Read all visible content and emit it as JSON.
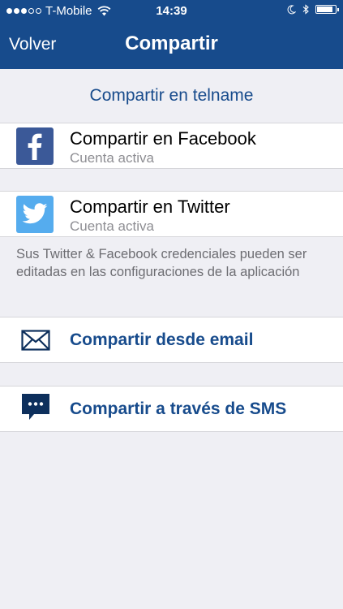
{
  "status_bar": {
    "carrier": "T-Mobile",
    "time": "14:39",
    "signal_bars": 3,
    "battery_level": 0.85
  },
  "nav": {
    "back_label": "Volver",
    "title": "Compartir"
  },
  "section": {
    "header": "Compartir en telname"
  },
  "accounts": [
    {
      "title": "Compartir en Facebook",
      "subtitle": "Cuenta activa",
      "icon": "facebook-icon",
      "color": "#3b5998"
    },
    {
      "title": "Compartir en Twitter",
      "subtitle": "Cuenta activa",
      "icon": "twitter-icon",
      "color": "#55acee"
    }
  ],
  "note": "Sus Twitter & Facebook credenciales pueden ser editadas en las configuraciones de la aplicación",
  "actions": [
    {
      "label": "Compartir desde email",
      "icon": "envelope-icon"
    },
    {
      "label": "Compartir a través de SMS",
      "icon": "sms-icon"
    }
  ],
  "colors": {
    "brand": "#174b8c",
    "background": "#efeff4"
  }
}
